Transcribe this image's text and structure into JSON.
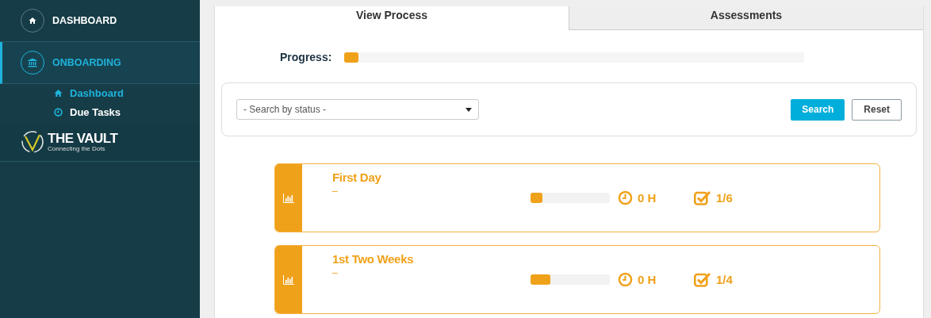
{
  "sidebar": {
    "items": [
      {
        "label": "DASHBOARD",
        "kind": "home",
        "selected": false
      },
      {
        "label": "ONBOARDING",
        "kind": "bank",
        "selected": true
      }
    ],
    "sub_items": [
      {
        "label": "Dashboard",
        "kind": "home",
        "selected": true
      },
      {
        "label": "Due Tasks",
        "kind": "clock",
        "selected": false
      }
    ],
    "logo": {
      "title": "THE VAULT",
      "tagline": "Connecting the Dots"
    }
  },
  "tabs": [
    {
      "label": "View Process",
      "selected": true
    },
    {
      "label": "Assessments",
      "selected": false
    }
  ],
  "progress": {
    "label": "Progress:",
    "level": 0.03
  },
  "filter": {
    "placeholder": "- Search by status -",
    "buttons": [
      {
        "label": "Search",
        "kind": "primary"
      },
      {
        "label": "Reset",
        "kind": "secondary"
      }
    ]
  },
  "processes": [
    {
      "title": "First Day",
      "description": "–",
      "level": 0.15,
      "hours": "0 H",
      "tasks": "1/6"
    },
    {
      "title": "1st Two Weeks",
      "description": "–",
      "level": 0.25,
      "hours": "0 H",
      "tasks": "1/4"
    }
  ]
}
